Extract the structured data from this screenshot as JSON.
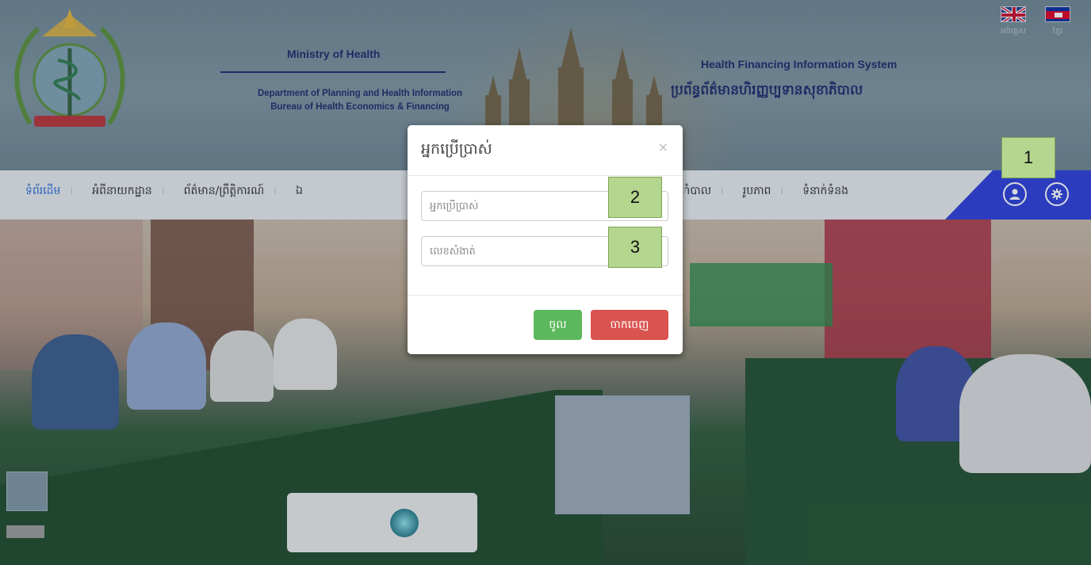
{
  "header": {
    "ministry": "Ministry of Health",
    "department": "Department of Planning and Health Information",
    "bureau": "Bureau of Health Economics & Financing",
    "system_title_en": "Health Financing Information System",
    "system_title_kh": "ប្រព័ន្ធព័ត៌មានហិរញ្ញប្បទានសុខាភិបាល",
    "languages": [
      {
        "label": "អង់គ្លេស",
        "flag": "uk-flag-icon"
      },
      {
        "label": "ខ្មែរ",
        "flag": "cambodia-flag-icon"
      }
    ]
  },
  "nav": {
    "items": [
      {
        "label": "ទំព័រដើម",
        "active": true
      },
      {
        "label": "អំពីនាយកដ្ឋាន"
      },
      {
        "label": "ព័ត៌មាន/ព្រឹត្តិការណ៍"
      },
      {
        "label": "ឯ"
      },
      {
        "label": "ាំបាល"
      },
      {
        "label": "រូបភាព"
      },
      {
        "label": "ទំនាក់ទំនង"
      }
    ],
    "user_icon": "user-icon",
    "settings_icon": "gear-icon"
  },
  "modal": {
    "title": "អ្នកប្រើប្រាស់",
    "close": "×",
    "username_placeholder": "អ្នកប្រើប្រាស់",
    "password_placeholder": "លេខសំងាត់",
    "login_label": "ចូល",
    "exit_label": "ចាកចេញ"
  },
  "callouts": {
    "one": "1",
    "two": "2",
    "three": "3"
  },
  "colors": {
    "nav_accent": "#2c3fd8",
    "login": "#5cb85c",
    "exit": "#d9534f",
    "callout": "#b5d68f"
  }
}
